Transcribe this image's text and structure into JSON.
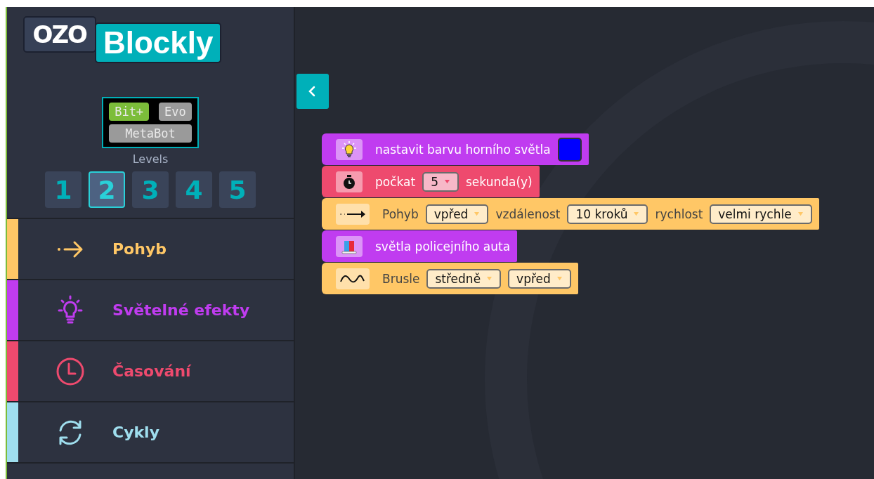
{
  "logo": {
    "left": "OZO",
    "right": "Blockly"
  },
  "robots": [
    {
      "label": "Bit+",
      "selected": true
    },
    {
      "label": "Evo",
      "selected": false
    },
    {
      "label": "MetaBot",
      "selected": false
    }
  ],
  "levels_label": "Levels",
  "levels": [
    {
      "label": "1",
      "selected": false
    },
    {
      "label": "2",
      "selected": true
    },
    {
      "label": "3",
      "selected": false
    },
    {
      "label": "4",
      "selected": false
    },
    {
      "label": "5",
      "selected": false
    }
  ],
  "categories": [
    {
      "label": "Pohyb",
      "kind": "move",
      "color": "#ffc766"
    },
    {
      "label": "Světelné efekty",
      "kind": "light",
      "color": "#c03cf0"
    },
    {
      "label": "Časování",
      "kind": "timing",
      "color": "#ee4a6e"
    },
    {
      "label": "Cykly",
      "kind": "loops",
      "color": "#9fdeee"
    }
  ],
  "blocks": [
    {
      "kind": "light",
      "color": "#c03cf0",
      "parts": [
        {
          "kind": "text",
          "text": "nastavit barvu horního světla"
        },
        {
          "kind": "color",
          "color": "#0000ff"
        }
      ]
    },
    {
      "kind": "wait",
      "color": "#ee4a6e",
      "parts": [
        {
          "kind": "text",
          "text": "počkat"
        },
        {
          "kind": "dropdown",
          "text": "5"
        },
        {
          "kind": "text",
          "text": "sekunda(y)"
        }
      ]
    },
    {
      "kind": "move",
      "color": "#ffc766",
      "parts": [
        {
          "kind": "text",
          "text": "Pohyb"
        },
        {
          "kind": "dropdown",
          "text": "vpřed"
        },
        {
          "kind": "text",
          "text": "vzdálenost"
        },
        {
          "kind": "dropdown",
          "text": "10 kroků"
        },
        {
          "kind": "text",
          "text": "rychlost"
        },
        {
          "kind": "dropdown",
          "text": "velmi rychle"
        }
      ]
    },
    {
      "kind": "police",
      "color": "#c03cf0",
      "parts": [
        {
          "kind": "text",
          "text": "světla policejního auta"
        }
      ]
    },
    {
      "kind": "skate",
      "color": "#ffc766",
      "parts": [
        {
          "kind": "text",
          "text": "Brusle"
        },
        {
          "kind": "dropdown",
          "text": "středně"
        },
        {
          "kind": "dropdown",
          "text": "vpřed"
        }
      ]
    }
  ]
}
